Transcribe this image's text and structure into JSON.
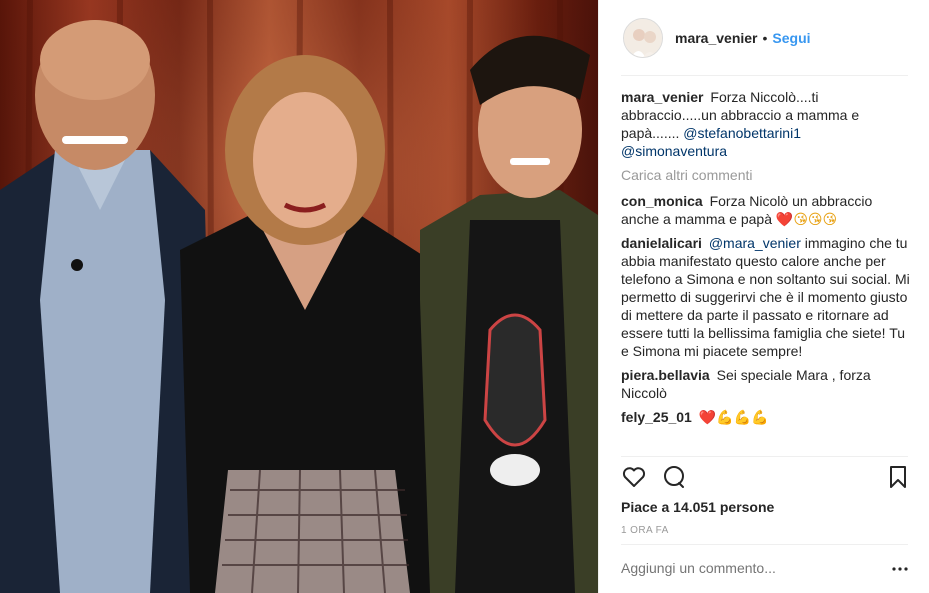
{
  "post": {
    "author": "mara_venier",
    "dot": "•",
    "follow_label": "Segui"
  },
  "caption": {
    "user": "mara_venier",
    "text": "Forza Niccolò....ti abbraccio.....un abbraccio a mamma e papà....... ",
    "mentions": [
      "@stefanobettarini1",
      "@simonaventura"
    ]
  },
  "load_more_label": "Carica altri commenti",
  "comments": [
    {
      "user": "con_monica",
      "text": "Forza Nicolò un abbraccio anche a mamma e papà ",
      "emoji": [
        "❤️",
        "😘",
        "😘",
        "😘"
      ]
    },
    {
      "user": "danielalicari",
      "mention": "@mara_venier",
      "text": " immagino che tu abbia manifestato questo calore anche per telefono a Simona e non soltanto sui social. Mi permetto di suggerirvi che è il momento giusto di mettere da parte il passato e ritornare ad essere tutti la bellissima famiglia che siete! Tu e Simona mi piacete sempre!"
    },
    {
      "user": "piera.bellavia",
      "text": "Sei speciale Mara , forza Niccolò"
    },
    {
      "user": "fely_25_01",
      "text": "",
      "emoji": [
        "❤️",
        "💪",
        "💪",
        "💪"
      ]
    }
  ],
  "likes_label": "Piace a 14.051 persone",
  "time_label": "1 ORA FA",
  "add_comment_placeholder": "Aggiungi un commento...",
  "icons": {
    "like": "heart-icon",
    "comment": "comment-icon",
    "save": "bookmark-icon",
    "more": "more-options-icon"
  },
  "colors": {
    "link": "#3897f0",
    "mention": "#003569",
    "muted": "#999999",
    "text": "#262626"
  }
}
